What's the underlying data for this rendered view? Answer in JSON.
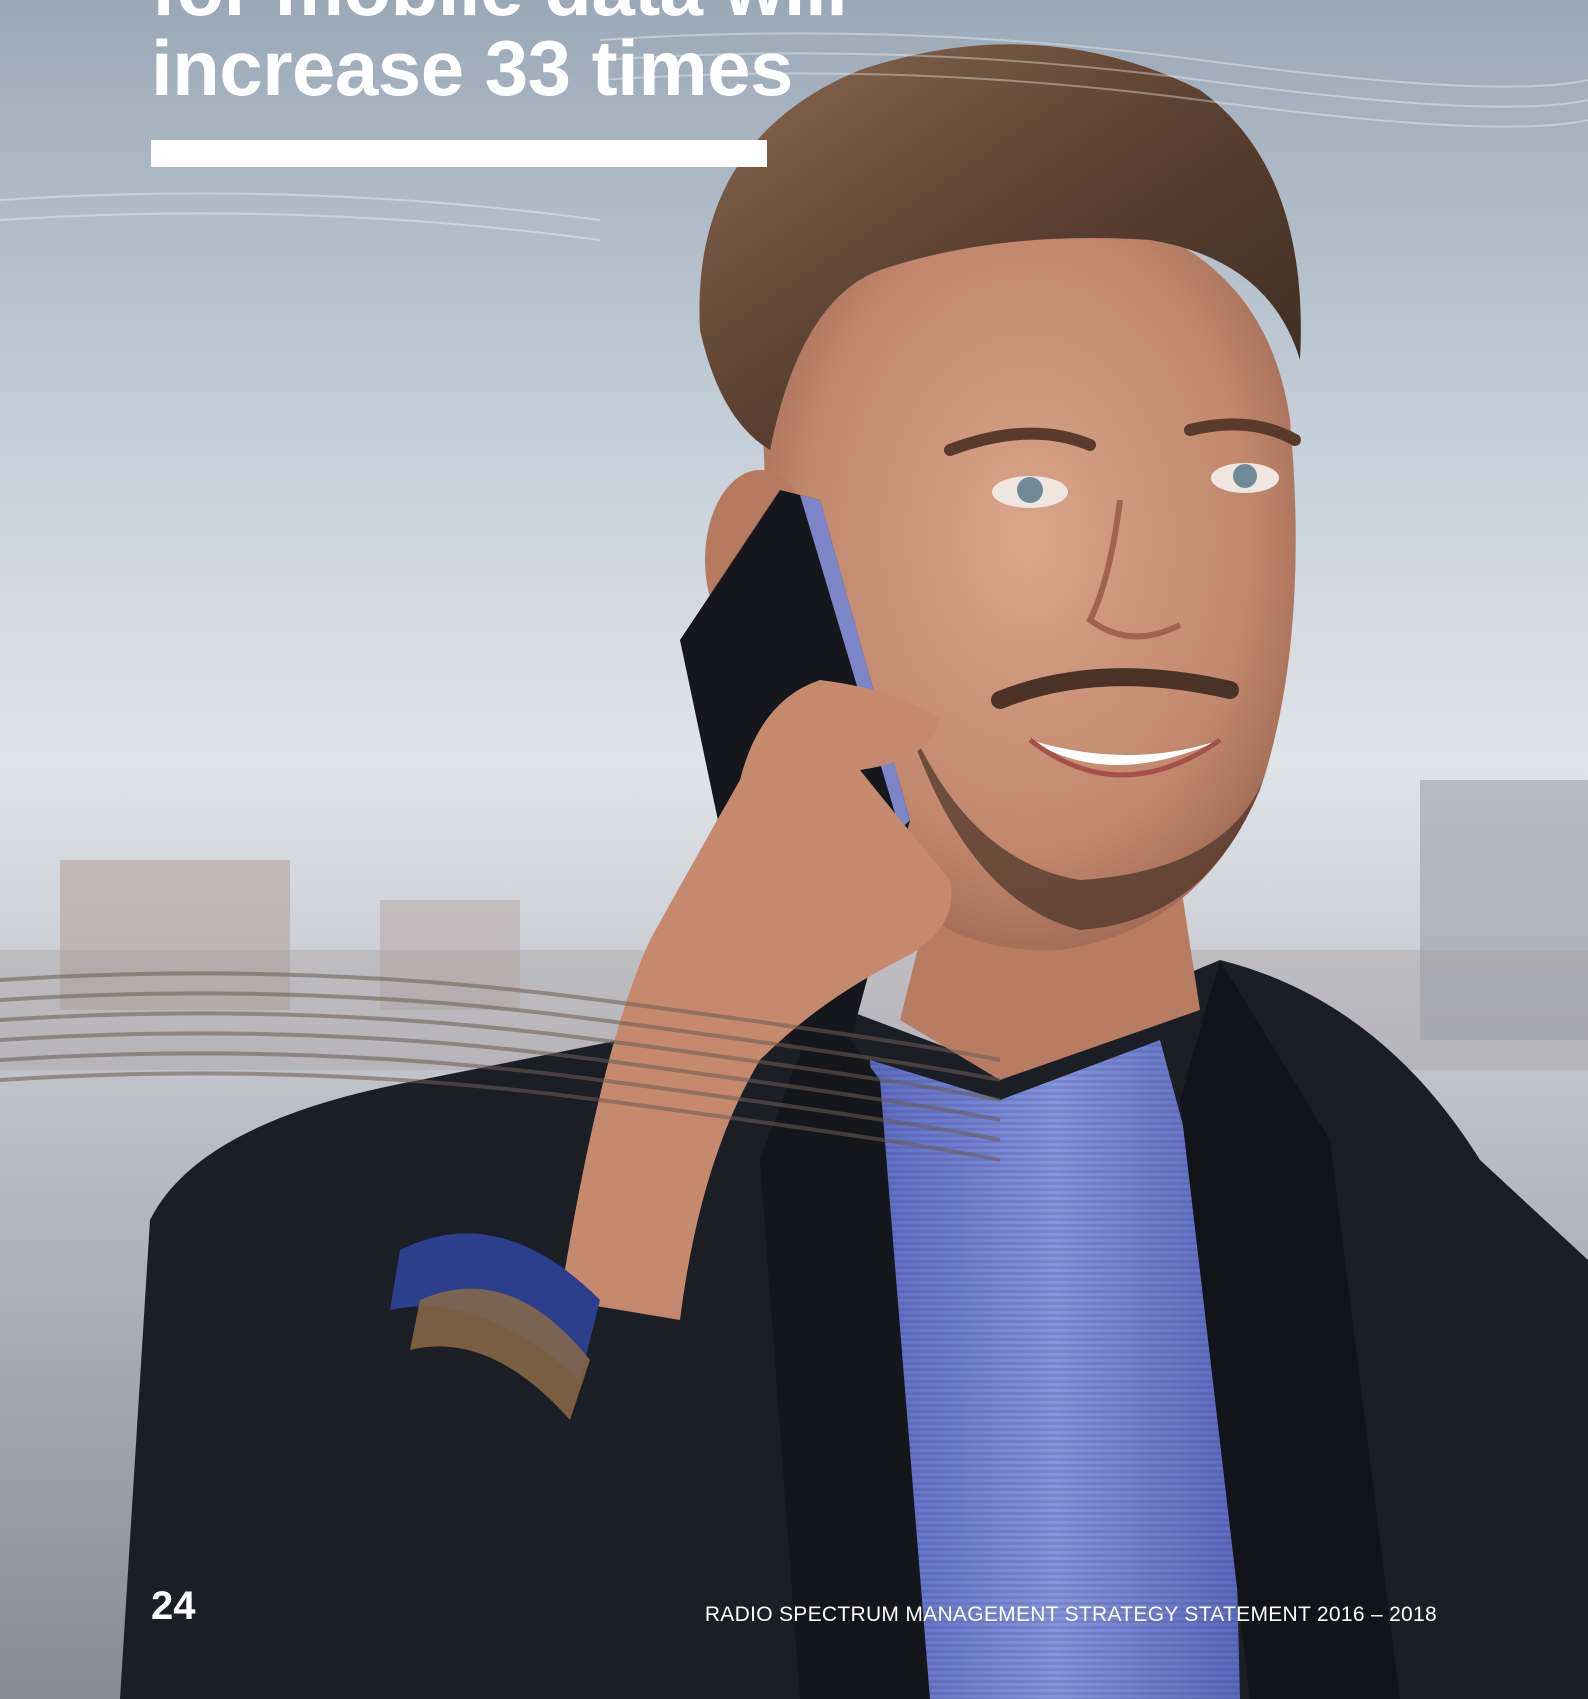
{
  "headline": {
    "lines": [
      "for mobile data will",
      "increase 33 times"
    ]
  },
  "footer": {
    "page_number": "24",
    "running_title": "RADIO SPECTRUM MANAGEMENT STRATEGY STATEMENT 2016 – 2018"
  },
  "colors": {
    "text": "#ffffff",
    "rule": "#ffffff",
    "sky": "#d6dde4",
    "coat": "#1c1e26",
    "shirt": "#6f7fd0"
  }
}
